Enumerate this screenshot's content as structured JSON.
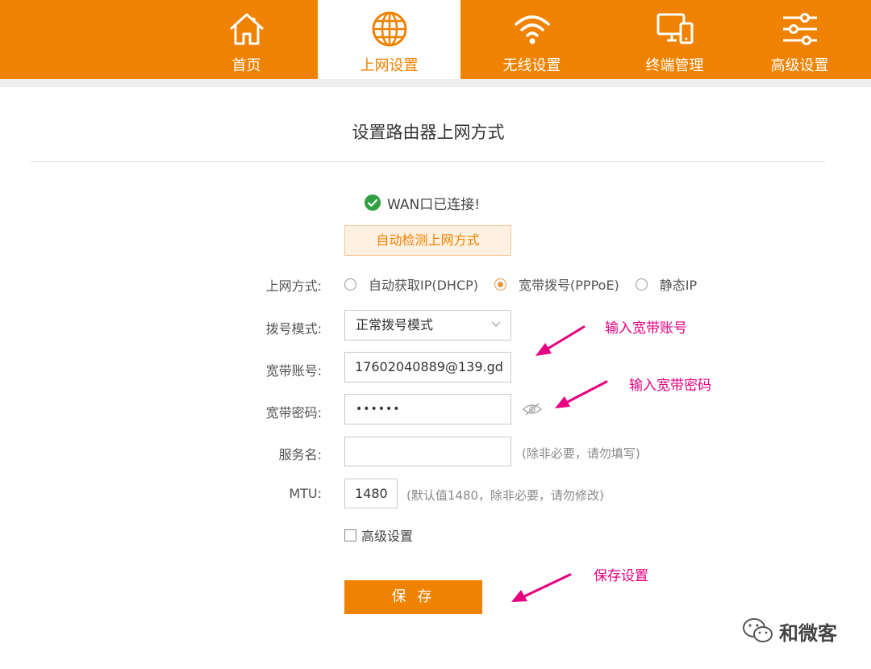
{
  "nav": {
    "tabs": [
      {
        "label": "首页",
        "icon": "home-icon",
        "active": false
      },
      {
        "label": "上网设置",
        "icon": "globe-icon",
        "active": true
      },
      {
        "label": "无线设置",
        "icon": "wifi-icon",
        "active": false
      },
      {
        "label": "终端管理",
        "icon": "devices-icon",
        "active": false
      },
      {
        "label": "高级设置",
        "icon": "sliders-icon",
        "active": false
      }
    ]
  },
  "main": {
    "title": "设置路由器上网方式",
    "wan_status": "WAN口已连接!",
    "detect_button": "自动检测上网方式",
    "mode": {
      "label": "上网方式:",
      "options": [
        "自动获取IP(DHCP)",
        "宽带拨号(PPPoE)",
        "静态IP"
      ],
      "selected": "宽带拨号(PPPoE)"
    },
    "dial_mode": {
      "label": "拨号模式:",
      "value": "正常拨号模式"
    },
    "account": {
      "label": "宽带账号:",
      "value": "17602040889@139.gd"
    },
    "password": {
      "label": "宽带密码:",
      "value": "••••••"
    },
    "service": {
      "label": "服务名:",
      "value": "",
      "hint": "(除非必要，请勿填写)"
    },
    "mtu": {
      "label": "MTU:",
      "value": "1480",
      "hint": "(默认值1480，除非必要，请勿修改)"
    },
    "advanced_checkbox": "高级设置",
    "save_button": "保 存"
  },
  "annotations": {
    "account": "输入宽带账号",
    "password": "输入宽带密码",
    "save": "保存设置"
  },
  "watermark": "和微客",
  "colors": {
    "accent": "#ef8200",
    "annotation": "#e4007f",
    "success": "#2da042"
  }
}
